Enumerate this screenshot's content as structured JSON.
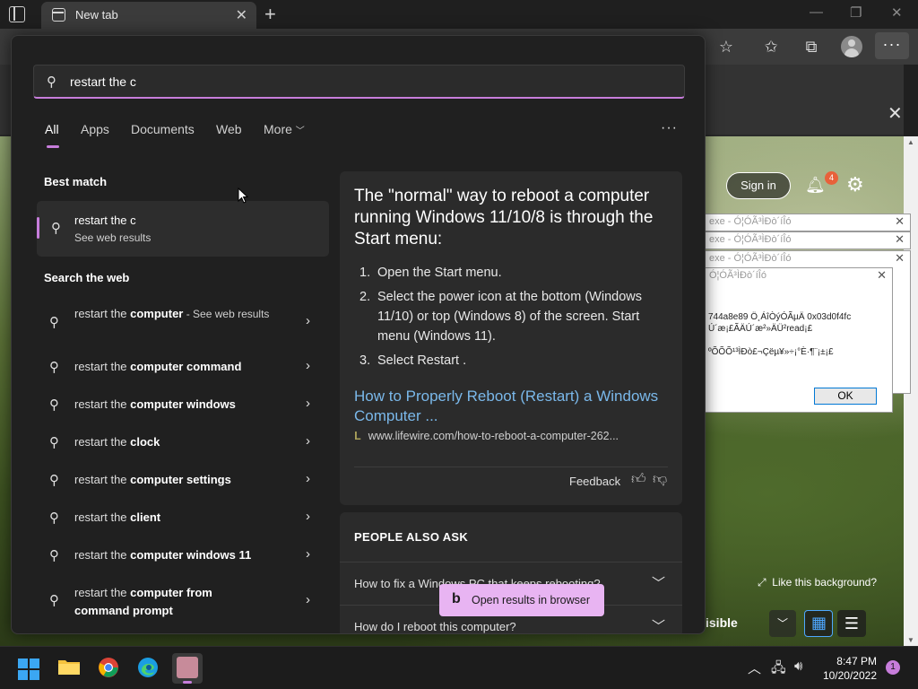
{
  "browser": {
    "tab_title": "New tab",
    "sign_in": "Sign in",
    "notification_count": "4",
    "like_background": "Like this background?",
    "visible_label": "isible"
  },
  "dialogs": {
    "title1": "exe - Ó¦ÓÃ³ÌÐò´íÎó",
    "title2": "exe - Ó¦ÓÃ³ÌÐò´íÎó",
    "title3": "exe - Ó¦ÓÃ³ÌÐò´íÎó",
    "title4": "Ó¦ÓÃ³ÌÐò´íÎó",
    "line1": "744a8e89 Ö¸ÁîÒýÓÃµÄ 0x03d0f4fc",
    "line2": "Ú´æ¡£ÃÄÚ´æ²»ÄÜ²read¡£",
    "line3": "ºÕÕÕ¹³ÌÐò£¬Çëµ¥»÷¡°È·¶¨¡±¡£",
    "ok_label": "OK"
  },
  "search": {
    "query": "restart the c",
    "filters": [
      "All",
      "Apps",
      "Documents",
      "Web",
      "More"
    ],
    "best_match_heading": "Best match",
    "best_match": {
      "title": "restart the c",
      "subtitle": "See web results"
    },
    "web_heading": "Search the web",
    "web_items": [
      {
        "prefix": "restart the ",
        "bold": "computer",
        "hint": " - See web results"
      },
      {
        "prefix": "restart the ",
        "bold": "computer command",
        "hint": ""
      },
      {
        "prefix": "restart the ",
        "bold": "computer windows",
        "hint": ""
      },
      {
        "prefix": "restart the ",
        "bold": "clock",
        "hint": ""
      },
      {
        "prefix": "restart the ",
        "bold": "computer settings",
        "hint": ""
      },
      {
        "prefix": "restart the ",
        "bold": "client",
        "hint": ""
      },
      {
        "prefix": "restart the ",
        "bold": "computer windows 11",
        "hint": ""
      },
      {
        "prefix": "restart the ",
        "bold": "computer from command prompt",
        "hint": ""
      }
    ]
  },
  "preview": {
    "heading": "The \"normal\" way to reboot a computer running Windows 11/10/8 is through the Start menu:",
    "steps": [
      "Open the Start menu.",
      "Select the power icon at the bottom (Windows 11/10) or top (Windows 8) of the screen. Start menu (Windows 11).",
      "Select Restart ."
    ],
    "link_text": "How to Properly Reboot (Restart) a Windows Computer ...",
    "url": "www.lifewire.com/how-to-reboot-a-computer-262...",
    "feedback": "Feedback",
    "paa_heading": "PEOPLE ALSO ASK",
    "paa_questions": [
      "How to fix a Windows PC that keeps rebooting?",
      "How do I reboot this computer?"
    ],
    "open_in_browser": "Open results in browser"
  },
  "taskbar": {
    "time": "8:47 PM",
    "date": "10/20/2022",
    "notification_count": "1"
  },
  "colors": {
    "accent": "#c77ddb",
    "link": "#7ab8ea",
    "panel": "#202020"
  }
}
